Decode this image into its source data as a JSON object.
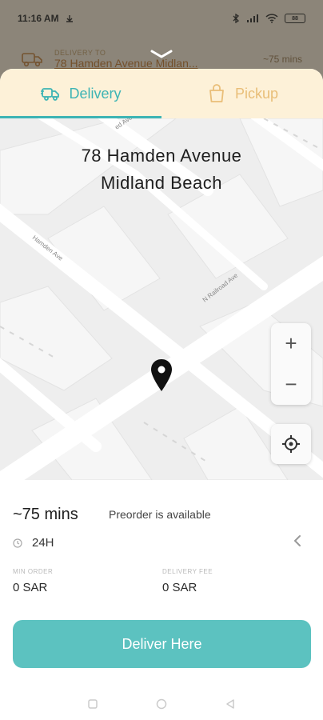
{
  "status": {
    "time": "11:16 AM",
    "battery": "88"
  },
  "prev_screen": {
    "label": "DELIVERY TO",
    "address": "78 Hamden Avenue Midlan...",
    "eta": "~75 mins"
  },
  "tabs": [
    {
      "label": "Delivery",
      "icon": "truck-icon",
      "active": true
    },
    {
      "label": "Pickup",
      "icon": "bag-icon",
      "active": false
    }
  ],
  "map": {
    "address_line1": "78 Hamden Avenue",
    "address_line2": "Midland Beach",
    "street_labels": [
      "Hamden Ave",
      "N Railroad Ave",
      "ed Ave"
    ],
    "zoom_in": "+",
    "zoom_out": "−"
  },
  "info": {
    "eta": "~75 mins",
    "preorder": "Preorder is available",
    "hours": "24H",
    "min_order_label": "MIN ORDER",
    "min_order_value": "0 SAR",
    "delivery_fee_label": "DELIVERY FEE",
    "delivery_fee_value": "0 SAR"
  },
  "actions": {
    "deliver": "Deliver Here"
  },
  "colors": {
    "accent": "#5cc2c0",
    "tab_bg": "#fdf1d8",
    "inactive_tab": "#e9be78"
  }
}
